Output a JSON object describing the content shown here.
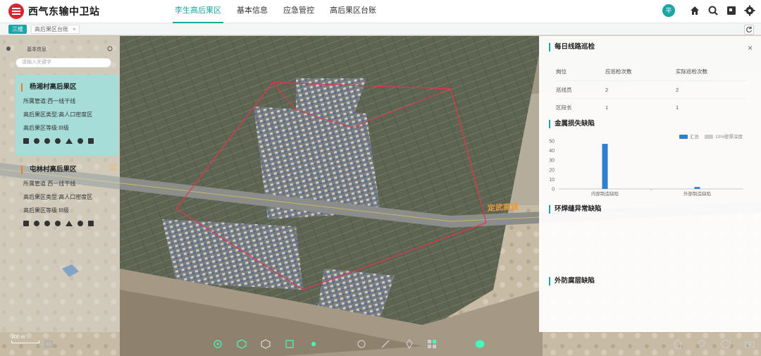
{
  "header": {
    "app_title": "西气东输中卫站",
    "nav": [
      "李生高后果区",
      "基本信息",
      "应急管控",
      "高后果区台账"
    ],
    "avatar": "平",
    "icons": [
      "home-icon",
      "search-icon",
      "fullscreen-icon",
      "settings-icon"
    ]
  },
  "tabs": {
    "home": "三维",
    "page": "高后果区台账",
    "close": "×"
  },
  "left_panel": {
    "title": "基本信息",
    "search_placeholder": "请输入关键字",
    "cards": [
      {
        "title": "杨湘村高后果区",
        "rows": [
          "所属管道:西一线干线",
          "高后果区类型:高人口密度区",
          "高后果区等级:III级"
        ]
      },
      {
        "title": "屯林村高后果区",
        "rows": [
          "所属管道:西一线干线",
          "高后果区类型:高人口密度区",
          "高后果区等级:III级"
        ]
      }
    ]
  },
  "map": {
    "road_label_left": "定",
    "road_label_right": "定武高速",
    "scale": "100 m"
  },
  "right_panel": {
    "close": "×",
    "patrol_title": "每日线路巡检",
    "patrol_table": {
      "headers": [
        "岗位",
        "应巡检次数",
        "实际巡检次数"
      ],
      "rows": [
        [
          "巡线员",
          "2",
          "2"
        ],
        [
          "区段长",
          "1",
          "1"
        ]
      ]
    },
    "metal_title": "金属损失缺陷",
    "weld_title": "环焊缝异常缺陷",
    "coating_title": "外防腐层缺陷"
  },
  "chart_data": {
    "type": "bar",
    "categories": [
      "内部制造缺陷",
      "外部制造缺陷"
    ],
    "series": [
      {
        "name": "汇总",
        "values": [
          47,
          2
        ]
      },
      {
        "name": "10%壁厚深度",
        "values": [
          0,
          0
        ]
      }
    ],
    "ylim": [
      0,
      50
    ],
    "yticks": [
      "50",
      "40",
      "30",
      "20",
      "10",
      "0"
    ],
    "legend": "top-right",
    "colors": [
      "#2f7fcf",
      "#cccccc"
    ]
  },
  "colors": {
    "accent": "#19a6a4",
    "brand_red": "#d7262d",
    "boundary": "#e8334a"
  }
}
